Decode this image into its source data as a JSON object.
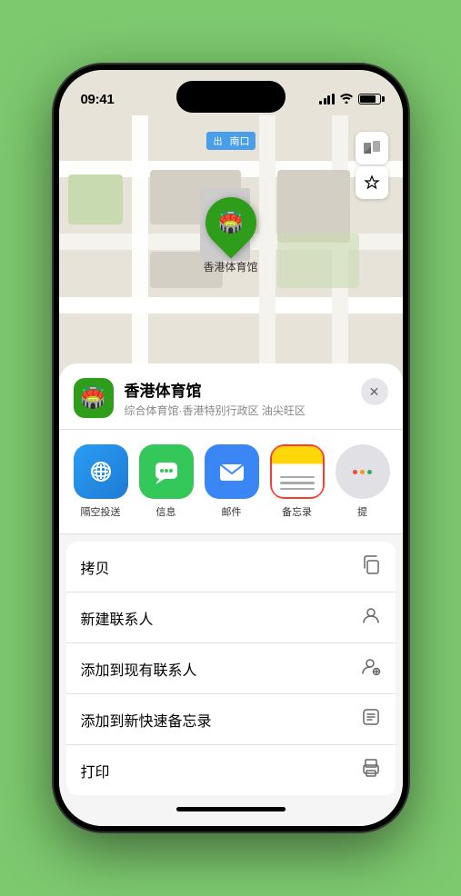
{
  "status_bar": {
    "time": "09:41",
    "arrow_symbol": "▶"
  },
  "map": {
    "label": "南口",
    "label_prefix": "出"
  },
  "marker": {
    "label": "香港体育馆",
    "icon": "🏟️"
  },
  "venue": {
    "name": "香港体育馆",
    "subtitle": "综合体育馆·香港特别行政区 油尖旺区",
    "icon": "🏟️"
  },
  "share_items": [
    {
      "id": "airdrop",
      "label": "隔空投送",
      "type": "airdrop"
    },
    {
      "id": "messages",
      "label": "信息",
      "type": "messages"
    },
    {
      "id": "mail",
      "label": "邮件",
      "type": "mail"
    },
    {
      "id": "notes",
      "label": "备忘录",
      "type": "notes"
    },
    {
      "id": "more",
      "label": "提",
      "type": "more"
    }
  ],
  "actions": [
    {
      "id": "copy",
      "label": "拷贝",
      "icon": "⎘"
    },
    {
      "id": "new-contact",
      "label": "新建联系人",
      "icon": "👤"
    },
    {
      "id": "add-existing",
      "label": "添加到现有联系人",
      "icon": "👤+"
    },
    {
      "id": "add-notes",
      "label": "添加到新快速备忘录",
      "icon": "📝"
    },
    {
      "id": "print",
      "label": "打印",
      "icon": "🖨"
    }
  ],
  "close_button_label": "✕",
  "map_control_map": "🗺",
  "map_control_location": "➤"
}
